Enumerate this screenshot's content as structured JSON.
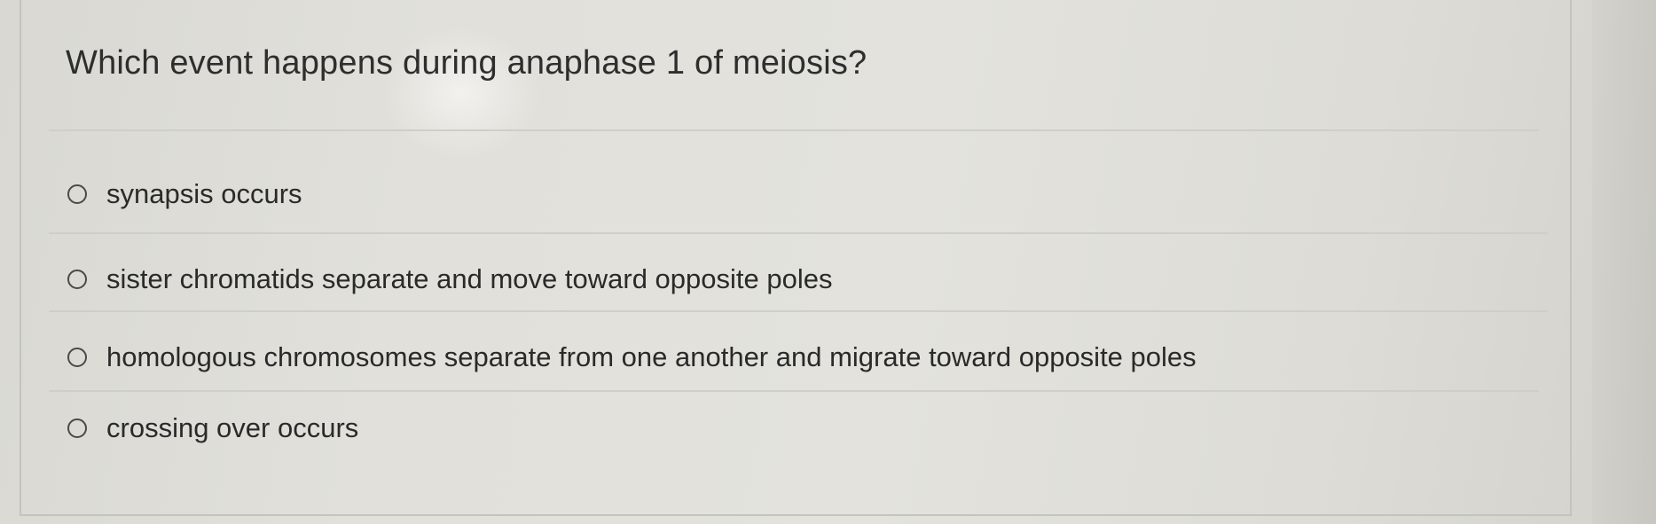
{
  "question": {
    "text": "Which event happens during anaphase 1 of meiosis?"
  },
  "options": [
    {
      "label": "synapsis occurs",
      "selected": false
    },
    {
      "label": "sister chromatids separate and move toward opposite poles",
      "selected": false
    },
    {
      "label": "homologous chromosomes separate from one another and migrate toward opposite poles",
      "selected": false
    },
    {
      "label": "crossing over occurs",
      "selected": false
    }
  ],
  "icons": {
    "option_marker": "radio-button-icon"
  }
}
